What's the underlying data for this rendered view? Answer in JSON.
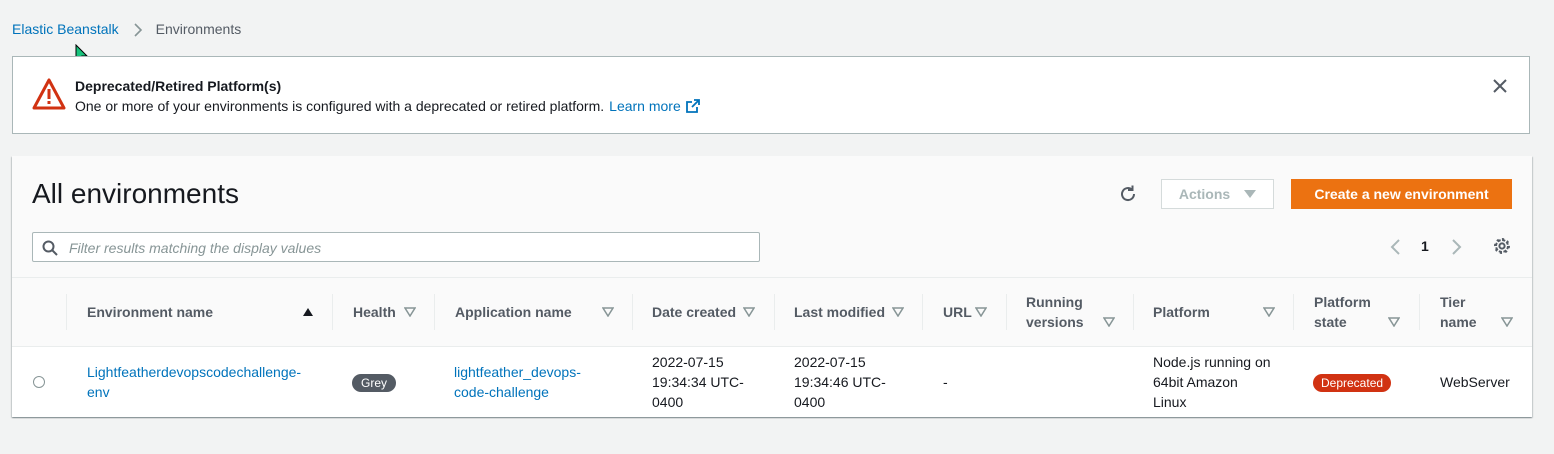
{
  "breadcrumb": {
    "root": "Elastic Beanstalk",
    "current": "Environments"
  },
  "flash": {
    "type": "warning",
    "title": "Deprecated/Retired Platform(s)",
    "message": "One or more of your environments is configured with a deprecated or retired platform.",
    "link_label": "Learn more",
    "icon": "warning-icon",
    "close_icon": "close-icon"
  },
  "panel": {
    "title": "All environments",
    "actions_label": "Actions",
    "create_label": "Create a new environment",
    "filter_placeholder": "Filter results matching the display values",
    "page": "1"
  },
  "table": {
    "columns": {
      "env_name": "Environment name",
      "health": "Health",
      "app_name": "Application name",
      "date_created": "Date created",
      "last_modified": "Last modified",
      "url": "URL",
      "running_versions_1": "Running",
      "running_versions_2": "versions",
      "platform": "Platform",
      "platform_state_1": "Platform",
      "platform_state_2": "state",
      "tier_1": "Tier",
      "tier_2": "name"
    },
    "rows": [
      {
        "env_name_1": "Lightfeatherdevopscodechallenge-",
        "env_name_2": "env",
        "health": "Grey",
        "app_name_1": "lightfeather_devops-",
        "app_name_2": "code-challenge",
        "date_created_1": "2022-07-15",
        "date_created_2": "19:34:34 UTC-",
        "date_created_3": "0400",
        "last_modified_1": "2022-07-15",
        "last_modified_2": "19:34:46 UTC-",
        "last_modified_3": "0400",
        "url": "-",
        "running_versions": "",
        "platform_1": "Node.js running on",
        "platform_2": "64bit Amazon",
        "platform_3": "Linux",
        "platform_state": "Deprecated",
        "tier": "WebServer"
      }
    ]
  },
  "colors": {
    "link": "#0073bb",
    "primary_button": "#ec7211",
    "warning": "#d13212",
    "grey_badge": "#545b64"
  }
}
